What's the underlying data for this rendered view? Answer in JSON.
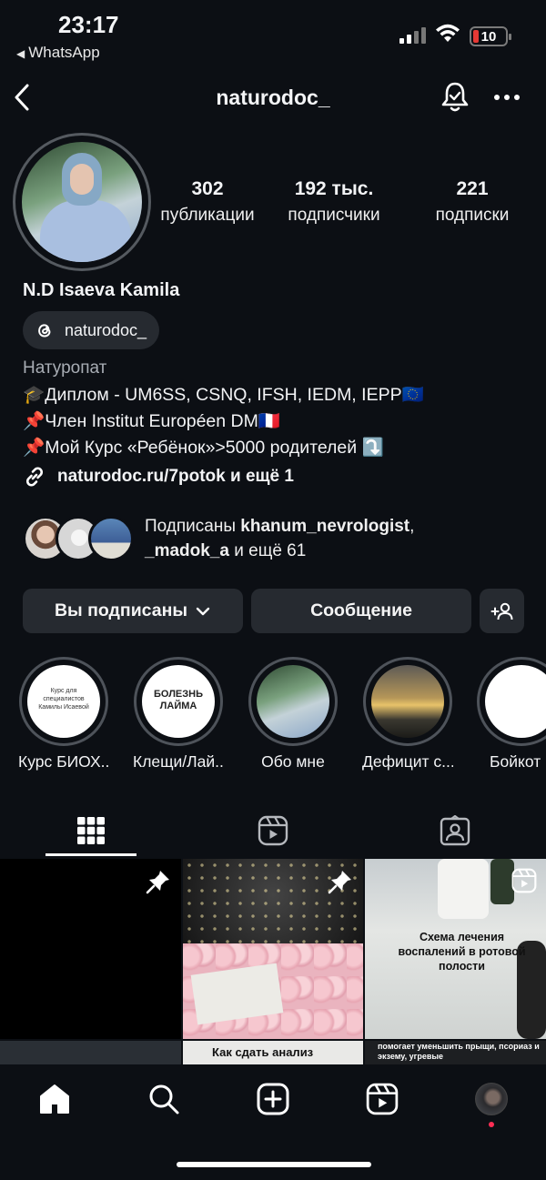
{
  "status_bar": {
    "time": "23:17",
    "back_app": "WhatsApp",
    "battery": "10"
  },
  "header": {
    "username": "naturodoc_"
  },
  "profile": {
    "stats": [
      {
        "value": "302",
        "label": "публикации"
      },
      {
        "value": "192 тыс.",
        "label": "подписчики"
      },
      {
        "value": "221",
        "label": "подписки"
      }
    ],
    "display_name": "N.D Isaeva Kamila",
    "threads_handle": "naturodoc_",
    "category": "Натуропат",
    "bio_lines": [
      "🎓Диплом - UM6SS, CSNQ, IFSH, IEDM, IEPP🇪🇺",
      "📌Член Institut Européen DM🇫🇷",
      "📌Мой Курс «Ребёнок»>5000 родителей ⤵️"
    ],
    "link": "naturodoc.ru/7potok и ещё 1",
    "followed_by": {
      "prefix": "Подписаны ",
      "user1": "khanum_nevrologist",
      "sep": ",",
      "user2": "_madok_a",
      "middle": " и ",
      "more": "ещё 61"
    }
  },
  "actions": {
    "following": "Вы подписаны",
    "message": "Сообщение"
  },
  "highlights": [
    {
      "label": "Курс БИОХ...",
      "inner_text": "Курс для специалистов Камилы Исаевой"
    },
    {
      "label": "Клещи/Лай...",
      "inner_text": "БОЛЕЗНЬ ЛАЙМА"
    },
    {
      "label": "Обо мне"
    },
    {
      "label": "Дефицит с..."
    },
    {
      "label": "Бойкот"
    }
  ],
  "tabs": [
    "grid-icon",
    "reels-icon",
    "tagged-icon"
  ],
  "posts": {
    "post3_text": "Схема лечения воспалений в ротовой полости",
    "post5_text": "Как сдать анализ",
    "post6_text": "помогает уменьшить прыщи, псориаз и экзему, угревые"
  },
  "bottom_nav": [
    "home-icon",
    "search-icon",
    "create-icon",
    "reels-icon",
    "profile-avatar"
  ],
  "colors": {
    "background": "#0c0f14",
    "button": "#262a30",
    "notification_dot": "#ff2e55",
    "battery_low": "#e53935"
  }
}
